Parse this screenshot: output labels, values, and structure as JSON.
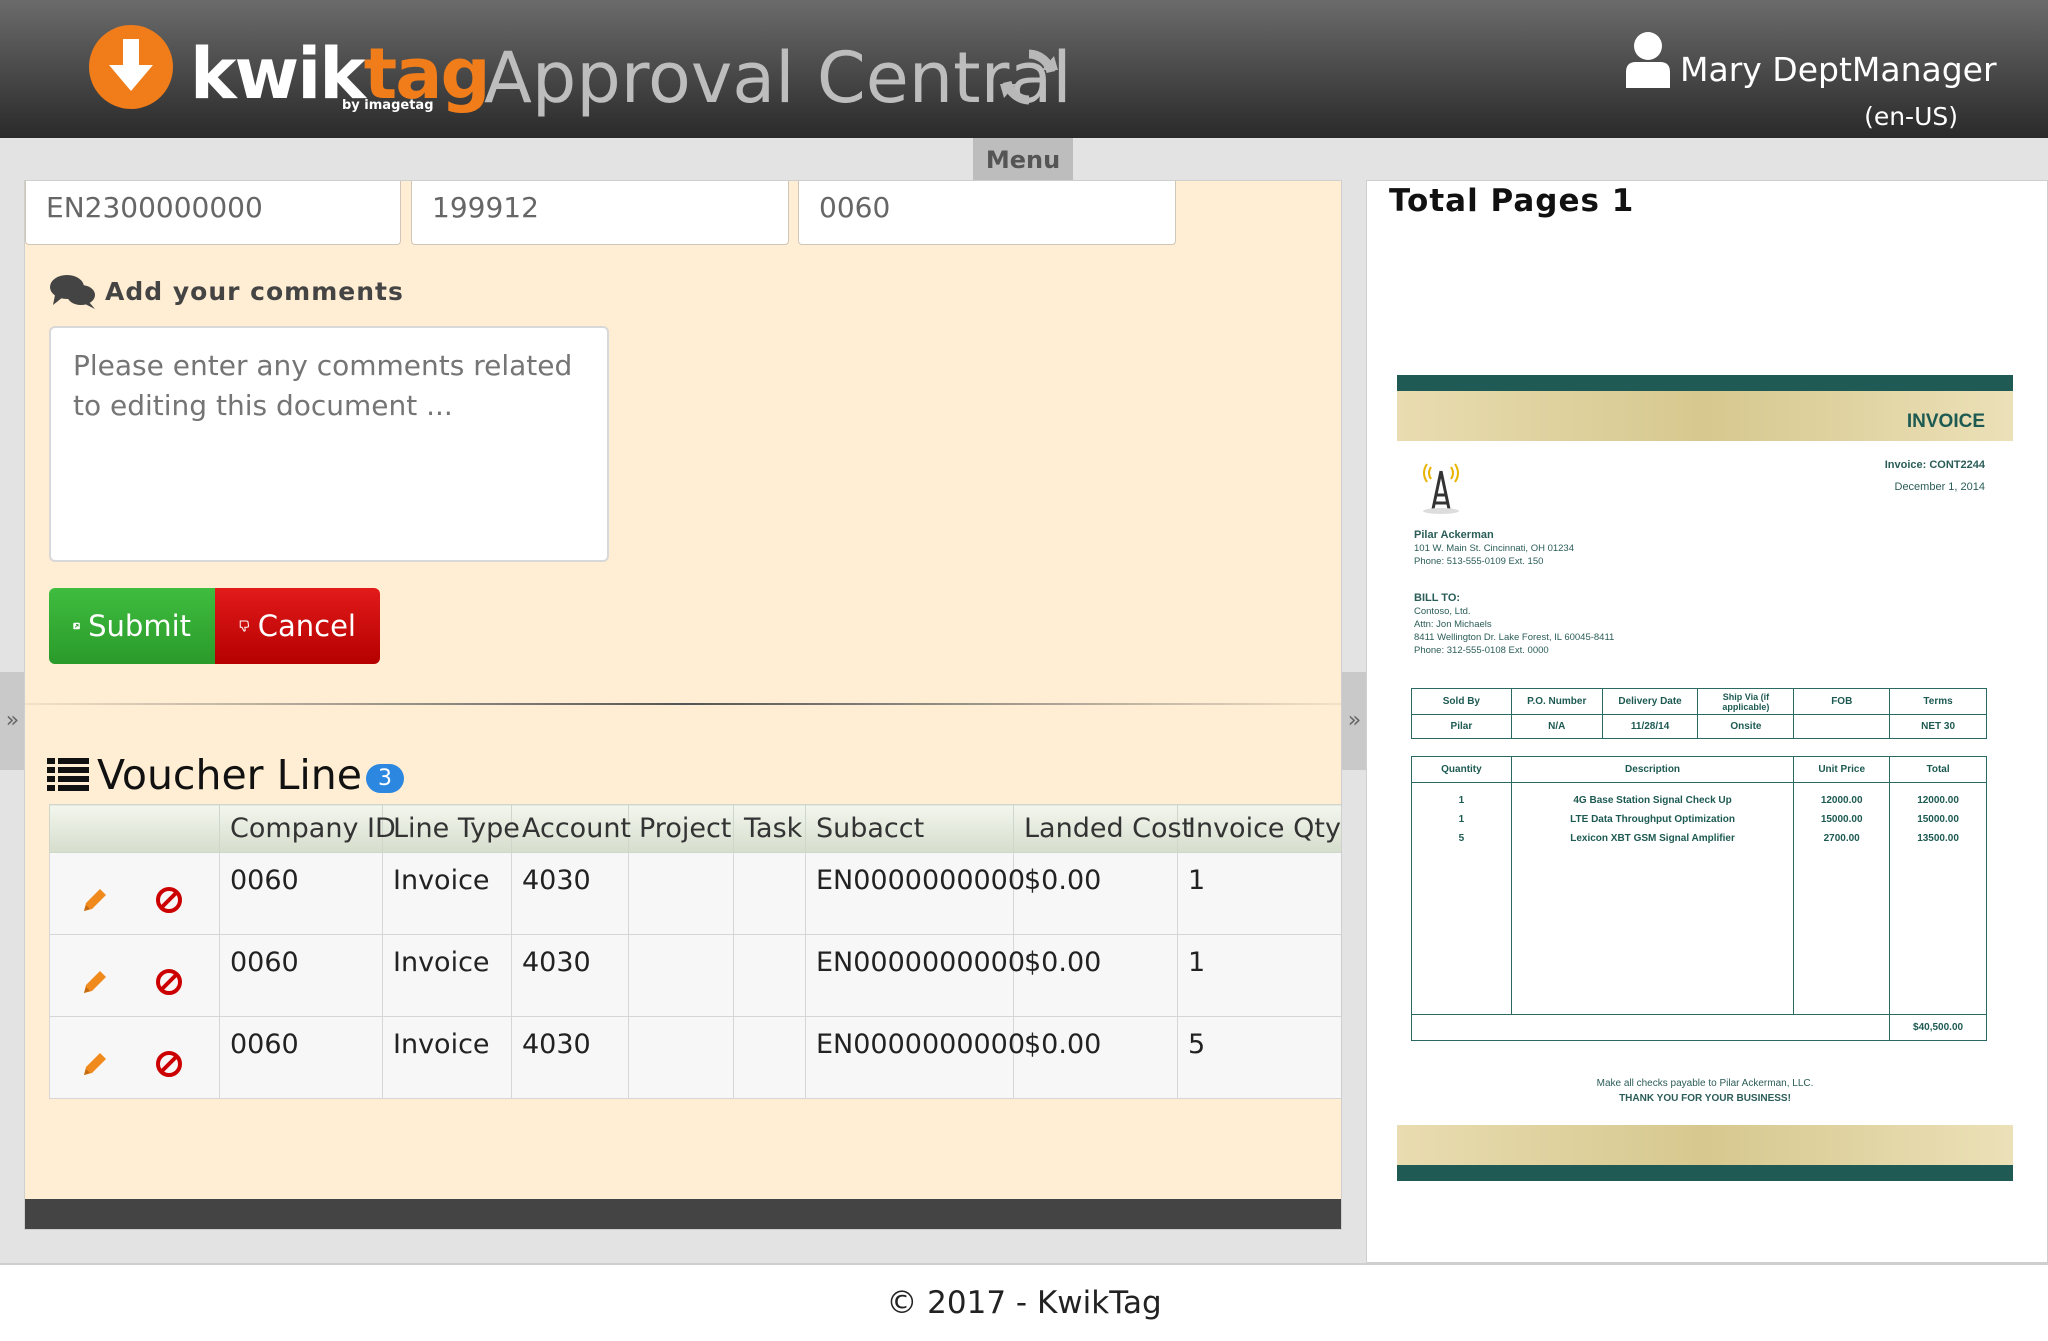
{
  "header": {
    "brand_kwik": "kwik",
    "brand_tag": "tag",
    "brand_sub": "by imagetag",
    "app_title": "Approval Central",
    "user_name": "Mary DeptManager",
    "user_locale": "(en-US)"
  },
  "menu": {
    "label": "Menu"
  },
  "fields": [
    "EN2300000000",
    "199912",
    "0060"
  ],
  "comments": {
    "label": "Add your comments",
    "placeholder": "Please enter any comments related to editing this document ..."
  },
  "buttons": {
    "submit": "Submit",
    "cancel": "Cancel"
  },
  "voucher": {
    "title": "Voucher Line",
    "count": "3",
    "columns": [
      "",
      "Company ID",
      "Line Type",
      "Account",
      "Project",
      "Task",
      "Subacct",
      "Landed Cost",
      "Invoice Qty"
    ],
    "rows": [
      [
        "0060",
        "Invoice",
        "4030",
        "",
        "",
        "EN0000000000",
        "$0.00",
        "1"
      ],
      [
        "0060",
        "Invoice",
        "4030",
        "",
        "",
        "EN0000000000",
        "$0.00",
        "1"
      ],
      [
        "0060",
        "Invoice",
        "4030",
        "",
        "",
        "EN0000000000",
        "$0.00",
        "5"
      ]
    ]
  },
  "preview": {
    "total_pages": "Total Pages 1",
    "invoice": {
      "title": "INVOICE",
      "number": "Invoice: CONT2244",
      "date": "December 1, 2014",
      "from_name": "Pilar Ackerman",
      "from_addr": "101 W. Main St. Cincinnati, OH 01234",
      "from_phone": "Phone: 513-555-0109 Ext. 150",
      "bill_to": "BILL TO:",
      "bill_lines": [
        "Contoso, Ltd.",
        "Attn: Jon Michaels",
        "8411 Wellington Dr. Lake Forest, IL 60045-8411",
        "Phone: 312-555-0108 Ext. 0000"
      ],
      "terms_headers": [
        "Sold By",
        "P.O. Number",
        "Delivery Date",
        "Ship Via (if applicable)",
        "FOB",
        "Terms"
      ],
      "terms_values": [
        "Pilar",
        "N/A",
        "11/28/14",
        "Onsite",
        "",
        "NET 30"
      ],
      "item_headers": [
        "Quantity",
        "Description",
        "Unit Price",
        "Total"
      ],
      "items": [
        [
          "1",
          "4G Base Station Signal Check Up",
          "12000.00",
          "12000.00"
        ],
        [
          "1",
          "LTE Data Throughput Optimization",
          "15000.00",
          "15000.00"
        ],
        [
          "5",
          "Lexicon XBT GSM Signal Amplifier",
          "2700.00",
          "13500.00"
        ]
      ],
      "grand_total": "$40,500.00",
      "note": "Make all checks payable to Pilar Ackerman, LLC.",
      "thanks": "THANK YOU FOR YOUR BUSINESS!"
    }
  },
  "footer": {
    "copyright": "© 2017 - KwikTag"
  },
  "colors": {
    "brand_orange": "#f07d1a",
    "submit_green": "#2fa82f",
    "cancel_red": "#cc0000",
    "badge_blue": "#2b87e0",
    "panel_bg": "#ffeed3"
  }
}
